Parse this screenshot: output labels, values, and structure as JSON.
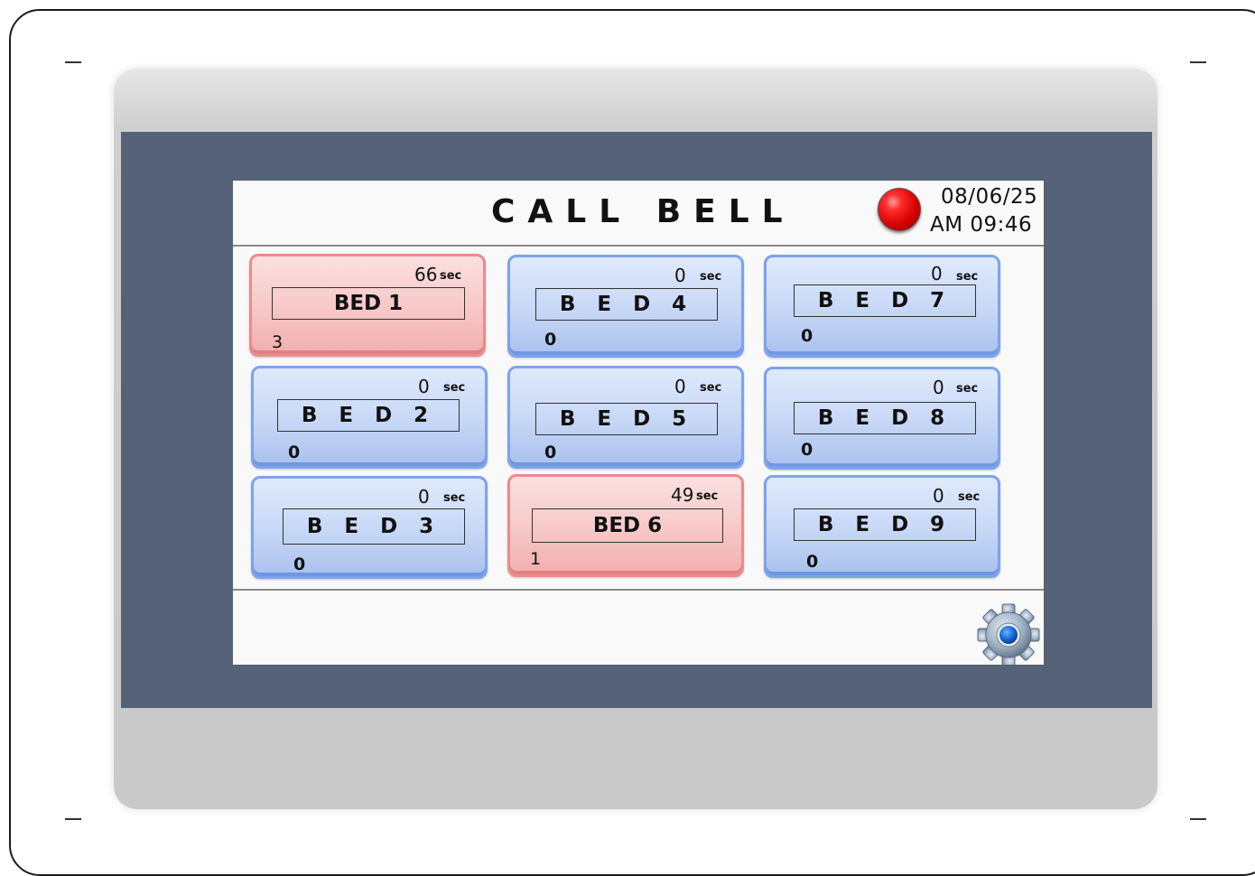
{
  "header": {
    "title": "CALL BELL",
    "date": "08/06/25",
    "time": "AM 09:46",
    "alarm_icon": "red-alarm-lamp-icon"
  },
  "beds": [
    {
      "name": "BED 1",
      "seconds": "66",
      "unit": "sec",
      "count": "3",
      "state": "active"
    },
    {
      "name": "B E D   2",
      "seconds": "0",
      "unit": "sec",
      "count": "0",
      "state": "idle"
    },
    {
      "name": "B E D   3",
      "seconds": "0",
      "unit": "sec",
      "count": "0",
      "state": "idle"
    },
    {
      "name": "B E D   4",
      "seconds": "0",
      "unit": "sec",
      "count": "0",
      "state": "idle"
    },
    {
      "name": "B E D   5",
      "seconds": "0",
      "unit": "sec",
      "count": "0",
      "state": "idle"
    },
    {
      "name": "BED 6",
      "seconds": "49",
      "unit": "sec",
      "count": "1",
      "state": "active"
    },
    {
      "name": "B E D   7",
      "seconds": "0",
      "unit": "sec",
      "count": "0",
      "state": "idle"
    },
    {
      "name": "B E D   8",
      "seconds": "0",
      "unit": "sec",
      "count": "0",
      "state": "idle"
    },
    {
      "name": "B E D   9",
      "seconds": "0",
      "unit": "sec",
      "count": "0",
      "state": "idle"
    }
  ],
  "footer": {
    "settings_icon": "gear-icon"
  },
  "colors": {
    "bezel": "#566277",
    "idle_tile": "#c6d7f6",
    "active_tile": "#f7c7c7",
    "alarm": "#ff2a2a"
  }
}
